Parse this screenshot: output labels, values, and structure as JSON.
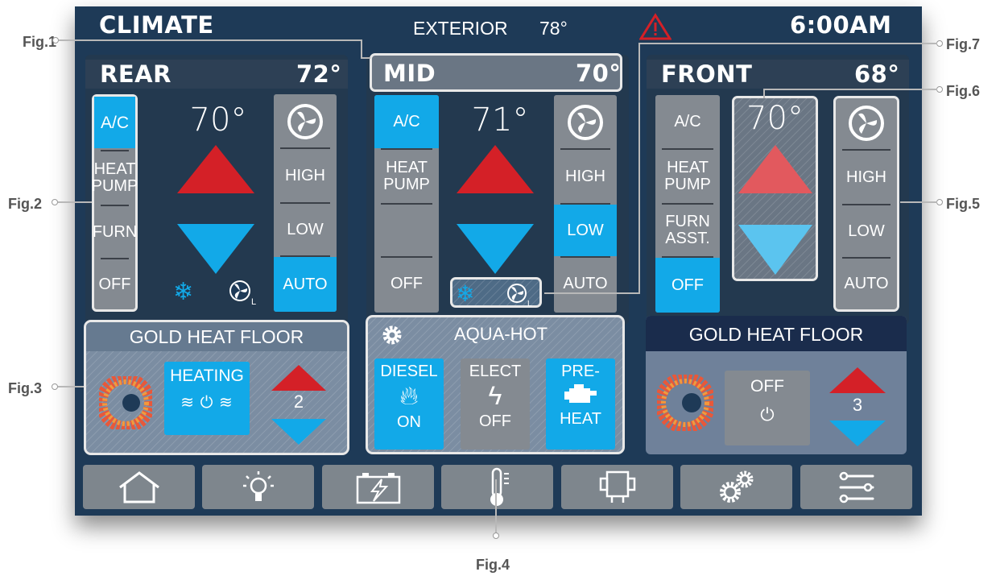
{
  "header": {
    "title": "CLIMATE",
    "exterior_label": "EXTERIOR",
    "exterior_temp": "78°",
    "time": "6:00AM"
  },
  "zones": {
    "rear": {
      "name": "REAR",
      "temp": "72°",
      "setpoint": "70°",
      "modes": [
        "A/C",
        "HEAT PUMP",
        "FURN",
        "OFF"
      ],
      "fan": [
        "HIGH",
        "LOW",
        "AUTO"
      ],
      "fan_badge": "L"
    },
    "mid": {
      "name": "MID",
      "temp": "70°",
      "setpoint": "71°",
      "modes": [
        "A/C",
        "HEAT PUMP",
        "",
        "OFF"
      ],
      "fan": [
        "HIGH",
        "LOW",
        "AUTO"
      ],
      "fan_badge": "L"
    },
    "front": {
      "name": "FRONT",
      "temp": "68°",
      "setpoint": "70°",
      "modes": [
        "A/C",
        "HEAT PUMP",
        "FURN ASST.",
        "OFF"
      ],
      "fan": [
        "HIGH",
        "LOW",
        "AUTO"
      ]
    }
  },
  "floor_rear": {
    "title": "GOLD HEAT FLOOR",
    "status": "HEATING",
    "level": "2"
  },
  "aqua": {
    "title": "AQUA-HOT",
    "diesel": {
      "label": "DIESEL",
      "state": "ON"
    },
    "elect": {
      "label": "ELECT",
      "state": "OFF"
    },
    "preheat": {
      "line1": "PRE-",
      "line2": "HEAT"
    }
  },
  "floor_front": {
    "title": "GOLD HEAT FLOOR",
    "status": "OFF",
    "level": "3"
  },
  "nav": [
    "home-icon",
    "light-bulb-icon",
    "battery-icon",
    "thermometer-icon",
    "generator-icon",
    "settings-gears-icon",
    "sliders-menu-icon"
  ],
  "figures": [
    "Fig.1",
    "Fig.2",
    "Fig.3",
    "Fig.4",
    "Fig.5",
    "Fig.6",
    "Fig.7"
  ],
  "colors": {
    "background": "#1e3a57",
    "active": "#12a9e8",
    "button": "#848a91",
    "heat_up": "#d42027",
    "cool_down": "#12a9e8",
    "alert": "#d42027"
  }
}
